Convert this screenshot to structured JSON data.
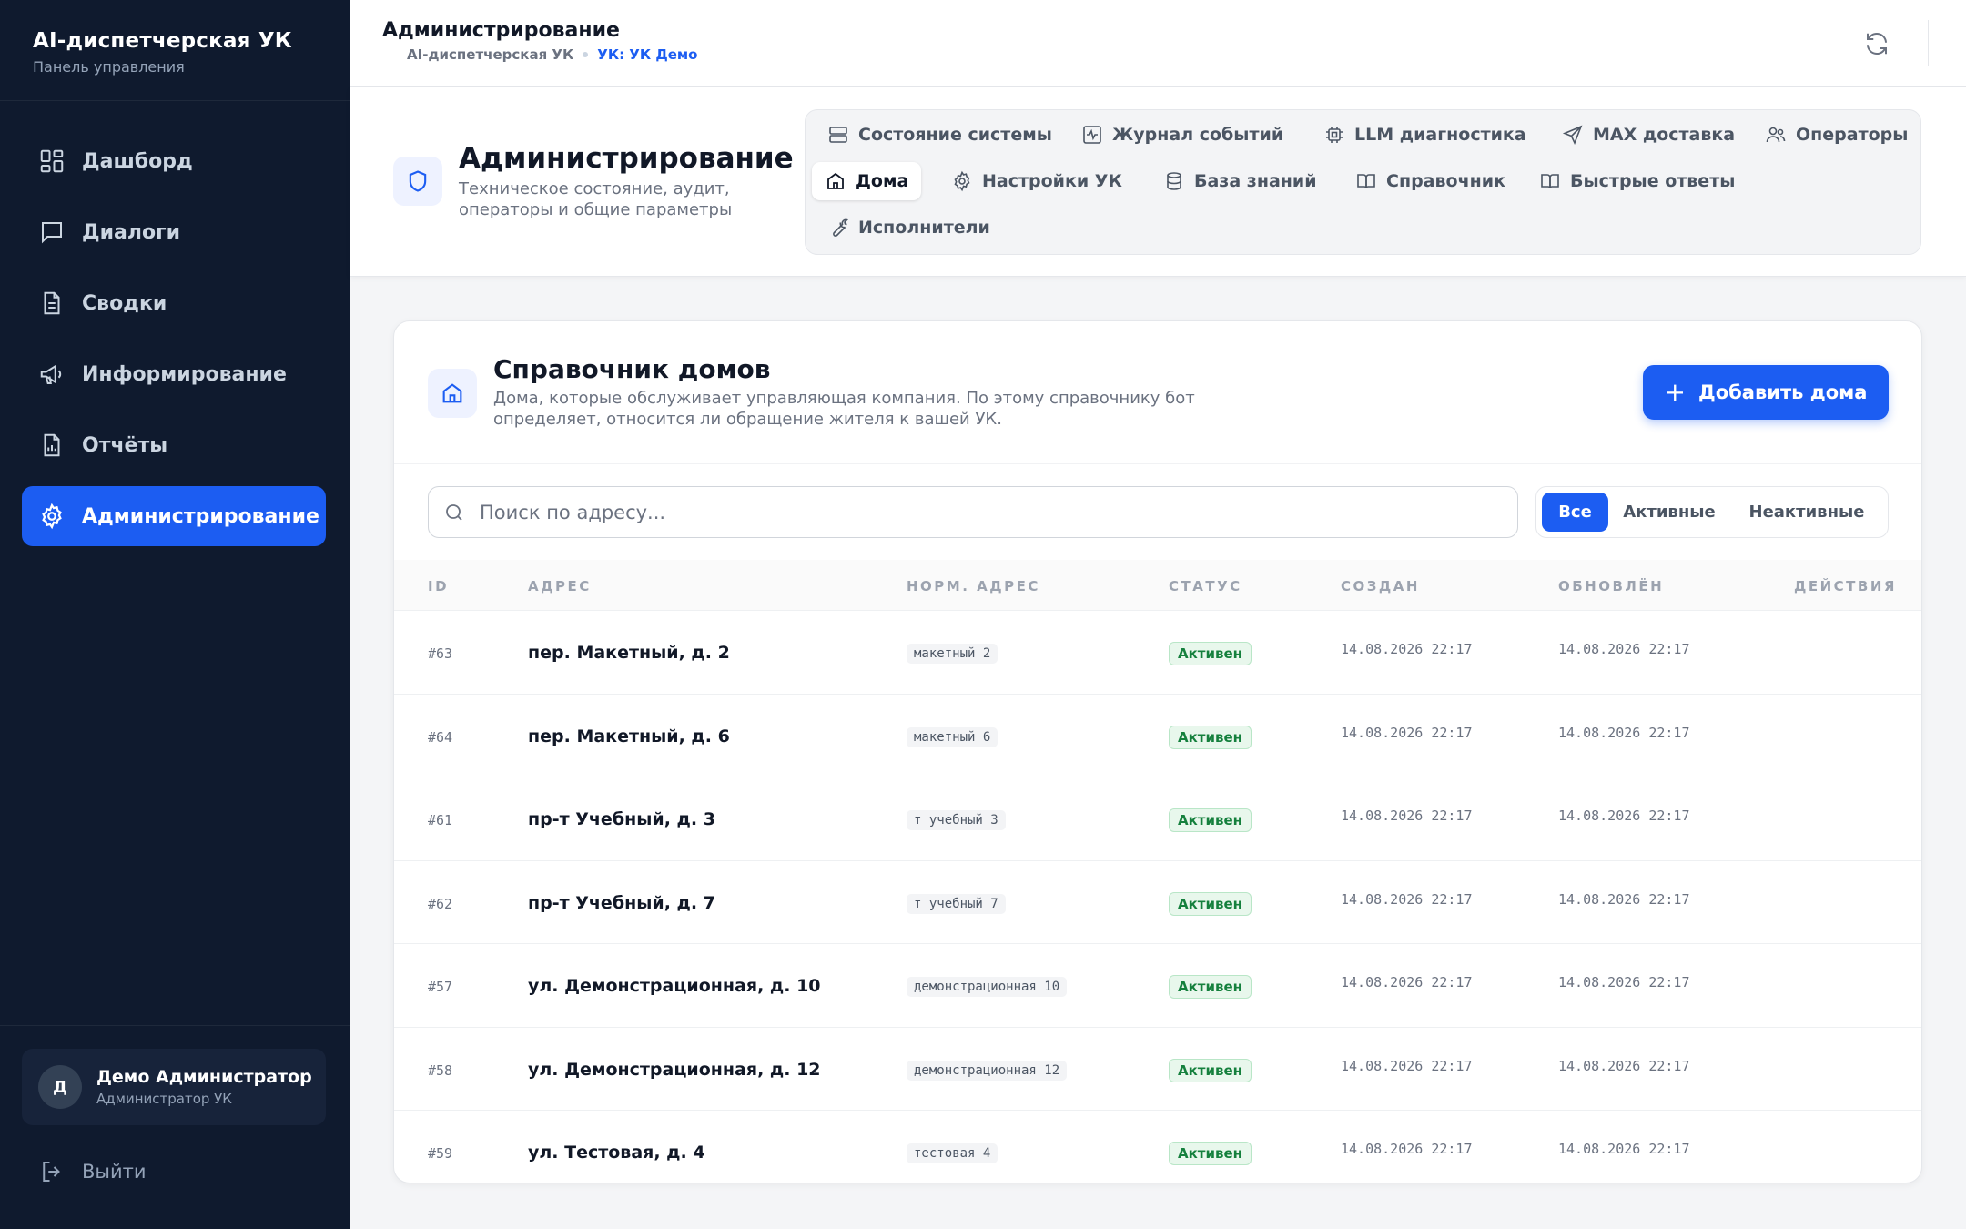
{
  "sidebar": {
    "brand_title": "AI-диспетчерская УК",
    "brand_subtitle": "Панель управления",
    "items": [
      {
        "label": "Дашборд",
        "icon": "dashboard-icon"
      },
      {
        "label": "Диалоги",
        "icon": "chat-icon"
      },
      {
        "label": "Сводки",
        "icon": "document-icon"
      },
      {
        "label": "Информирование",
        "icon": "megaphone-icon"
      },
      {
        "label": "Отчёты",
        "icon": "report-icon"
      },
      {
        "label": "Администрирование",
        "icon": "gear-icon",
        "active": true
      }
    ],
    "user": {
      "initial": "Д",
      "name": "Демо Администратор",
      "role": "Администратор УК"
    },
    "logout_label": "Выйти"
  },
  "header": {
    "title": "Администрирование",
    "breadcrumb": {
      "app": "AI-диспетчерская УК",
      "org": "УК: УК Демо"
    }
  },
  "page": {
    "title": "Администрирование",
    "subtitle": "Техническое состояние, аудит, операторы и общие параметры",
    "tabs": [
      {
        "label": "Состояние системы",
        "icon": "server-icon"
      },
      {
        "label": "Журнал событий",
        "icon": "activity-icon"
      },
      {
        "label": "LLM диагностика",
        "icon": "cpu-icon"
      },
      {
        "label": "MAX доставка",
        "icon": "send-icon"
      },
      {
        "label": "Операторы",
        "icon": "users-icon"
      },
      {
        "label": "Дома",
        "icon": "home-icon",
        "active": true
      },
      {
        "label": "Настройки УК",
        "icon": "gear-icon"
      },
      {
        "label": "База знаний",
        "icon": "database-icon"
      },
      {
        "label": "Справочник",
        "icon": "book-icon"
      },
      {
        "label": "Быстрые ответы",
        "icon": "book-icon"
      },
      {
        "label": "Исполнители",
        "icon": "wrench-icon"
      }
    ]
  },
  "houses": {
    "title": "Справочник домов",
    "subtitle": "Дома, которые обслуживает управляющая компания. По этому справочнику бот определяет, относится ли обращение жителя к вашей УК.",
    "add_button": "Добавить дома",
    "search_placeholder": "Поиск по адресу...",
    "filters": [
      {
        "label": "Все",
        "active": true
      },
      {
        "label": "Активные"
      },
      {
        "label": "Неактивные"
      }
    ],
    "columns": [
      "ID",
      "АДРЕС",
      "НОРМ. АДРЕС",
      "СТАТУС",
      "СОЗДАН",
      "ОБНОВЛЁН",
      "ДЕЙСТВИЯ"
    ],
    "rows": [
      {
        "id": "#63",
        "address": "пер. Макетный, д. 2",
        "norm": "макетный 2",
        "status": "Активен",
        "created": "14.08.2026 22:17",
        "updated": "14.08.2026 22:17"
      },
      {
        "id": "#64",
        "address": "пер. Макетный, д. 6",
        "norm": "макетный 6",
        "status": "Активен",
        "created": "14.08.2026 22:17",
        "updated": "14.08.2026 22:17"
      },
      {
        "id": "#61",
        "address": "пр-т Учебный, д. 3",
        "norm": "т учебный 3",
        "status": "Активен",
        "created": "14.08.2026 22:17",
        "updated": "14.08.2026 22:17"
      },
      {
        "id": "#62",
        "address": "пр-т Учебный, д. 7",
        "norm": "т учебный 7",
        "status": "Активен",
        "created": "14.08.2026 22:17",
        "updated": "14.08.2026 22:17"
      },
      {
        "id": "#57",
        "address": "ул. Демонстрационная, д. 10",
        "norm": "демонстрационная 10",
        "status": "Активен",
        "created": "14.08.2026 22:17",
        "updated": "14.08.2026 22:17"
      },
      {
        "id": "#58",
        "address": "ул. Демонстрационная, д. 12",
        "norm": "демонстрационная 12",
        "status": "Активен",
        "created": "14.08.2026 22:17",
        "updated": "14.08.2026 22:17"
      },
      {
        "id": "#59",
        "address": "ул. Тестовая, д. 4",
        "norm": "тестовая 4",
        "status": "Активен",
        "created": "14.08.2026 22:17",
        "updated": "14.08.2026 22:17"
      }
    ]
  },
  "colors": {
    "sidebar_bg": "#0f1a2e",
    "accent": "#1c5df2",
    "status_active_text": "#15803d",
    "status_active_bg": "#e8f7ec"
  }
}
